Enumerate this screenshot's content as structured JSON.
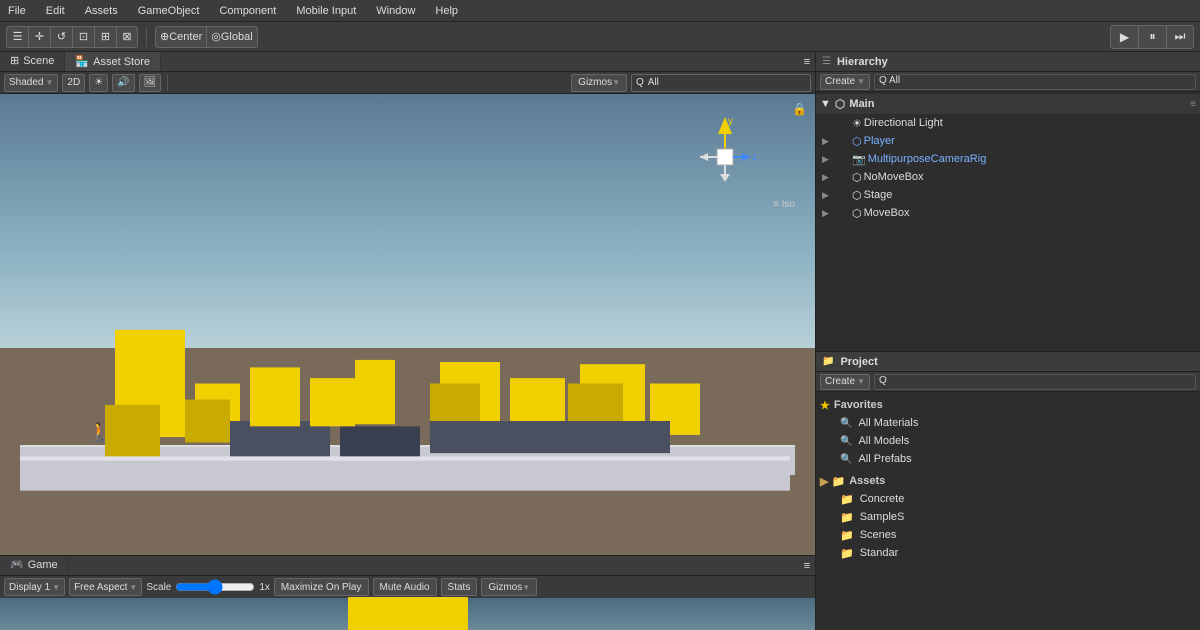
{
  "menu": {
    "items": [
      "File",
      "Edit",
      "Assets",
      "GameObject",
      "Component",
      "Mobile Input",
      "Window",
      "Help"
    ]
  },
  "toolbar": {
    "tools": [
      "☰",
      "✛",
      "↺",
      "⊡",
      "⊞",
      "⊠"
    ],
    "center_label": "Center",
    "global_label": "Global",
    "play": "▶",
    "pause": "⏸",
    "step": "⏭"
  },
  "scene_tab": {
    "label": "Scene",
    "icon": "scene-icon",
    "asset_store_label": "Asset Store",
    "asset_store_icon": "store-icon"
  },
  "scene_toolbar": {
    "shaded_label": "Shaded",
    "twod_label": "2D",
    "sun_icon": "☀",
    "speaker_icon": "🔊",
    "image_icon": "🖼",
    "gizmos_label": "Gizmos",
    "search_placeholder": "All",
    "search_prefix": "Q"
  },
  "hierarchy": {
    "title": "Hierarchy",
    "create_label": "Create",
    "search_placeholder": "All",
    "search_prefix": "Q",
    "items": [
      {
        "name": "Main",
        "indent": 0,
        "type": "root",
        "expanded": true,
        "icon": "unity-icon"
      },
      {
        "name": "Directional Light",
        "indent": 1,
        "type": "item",
        "expanded": false
      },
      {
        "name": "Player",
        "indent": 1,
        "type": "item",
        "expanded": false,
        "highlighted": true
      },
      {
        "name": "MultipurposeCameraRig",
        "indent": 1,
        "type": "item",
        "expanded": false,
        "highlighted": true
      },
      {
        "name": "NoMoveBox",
        "indent": 1,
        "type": "item",
        "expanded": false
      },
      {
        "name": "Stage",
        "indent": 1,
        "type": "item",
        "expanded": false
      },
      {
        "name": "MoveBox",
        "indent": 1,
        "type": "item",
        "expanded": false
      }
    ]
  },
  "project": {
    "title": "Project",
    "create_label": "Create",
    "search_placeholder": "Q",
    "favorites_label": "Favorites",
    "favorites_items": [
      {
        "label": "All Materials",
        "icon": "search"
      },
      {
        "label": "All Models",
        "icon": "search"
      },
      {
        "label": "All Prefabs",
        "icon": "search"
      }
    ],
    "assets_label": "Assets",
    "assets_items": [
      {
        "label": "Concrete",
        "icon": "folder"
      },
      {
        "label": "SampleS",
        "icon": "folder"
      },
      {
        "label": "Scenes",
        "icon": "folder"
      },
      {
        "label": "Standar",
        "icon": "folder"
      }
    ]
  },
  "game_panel": {
    "tab_label": "Game",
    "display_label": "Display 1",
    "aspect_label": "Free Aspect",
    "scale_label": "Scale",
    "scale_value": "1x",
    "maximize_label": "Maximize On Play",
    "mute_label": "Mute Audio",
    "stats_label": "Stats",
    "gizmos_label": "Gizmos"
  },
  "gizmo": {
    "y_label": "y",
    "z_label": "z",
    "iso_label": "Iso"
  },
  "colors": {
    "accent_blue": "#2a4a7a",
    "highlight_blue": "#7ab0ff",
    "yellow": "#f0d000",
    "sky_top": "#5a7a94",
    "sky_bottom": "#b8d0d8",
    "ground": "#7a6a5a"
  }
}
